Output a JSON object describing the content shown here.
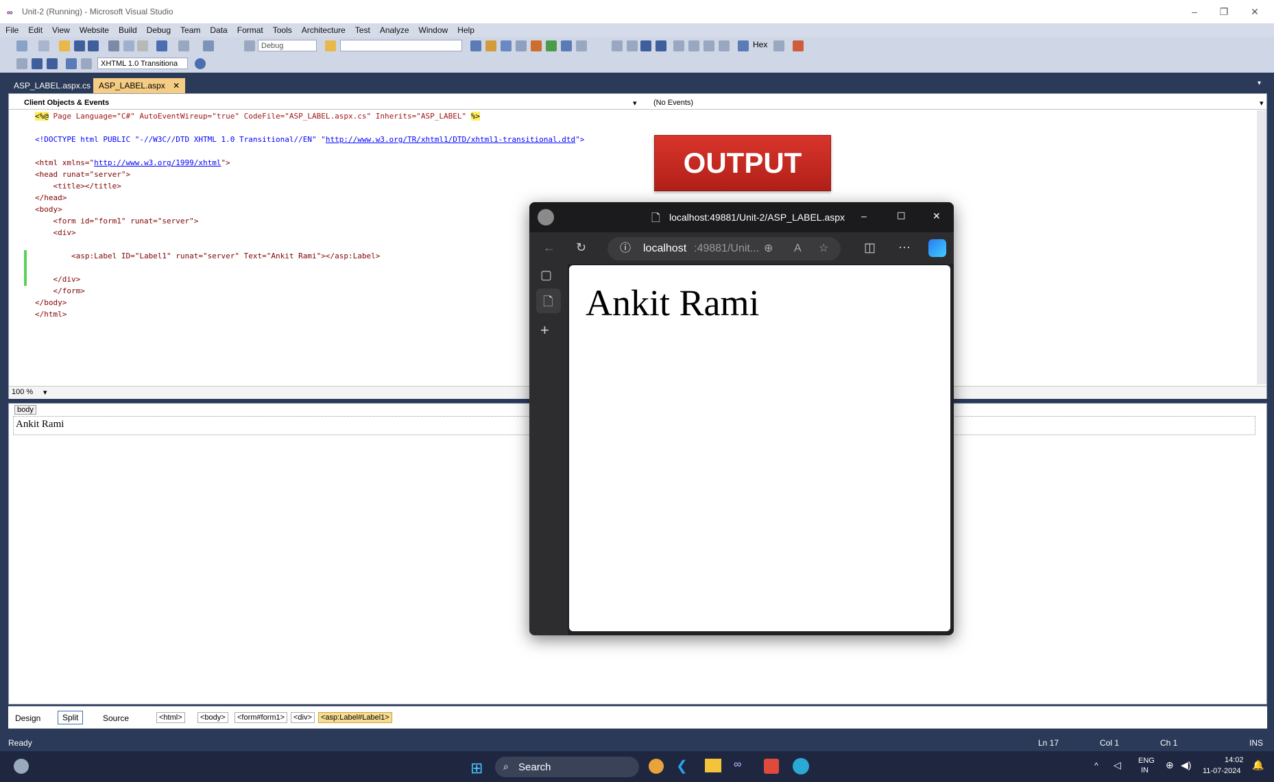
{
  "window": {
    "title": "Unit-2 (Running) - Microsoft Visual Studio"
  },
  "menu": [
    "File",
    "Edit",
    "View",
    "Website",
    "Build",
    "Debug",
    "Team",
    "Data",
    "Format",
    "Tools",
    "Architecture",
    "Test",
    "Analyze",
    "Window",
    "Help"
  ],
  "toolbar": {
    "config_value": "Debug",
    "hex_label": "Hex",
    "doctype_value": "XHTML 1.0 Transitiona"
  },
  "tabs": [
    {
      "label": "ASP_LABEL.aspx.cs",
      "active": false
    },
    {
      "label": "ASP_LABEL.aspx",
      "active": true
    }
  ],
  "editor": {
    "objects_dropdown": "Client Objects & Events",
    "events_dropdown": "(No Events)",
    "zoom": "100 %",
    "code": {
      "l1_a": "<%@",
      "l1_b": " Page Language=\"C#\" AutoEventWireup=\"true\" CodeFile=\"ASP_LABEL.aspx.cs\" Inherits=\"ASP_LABEL\" ",
      "l1_c": "%>",
      "l2_a": "<!DOCTYPE html PUBLIC \"-//W3C//DTD XHTML 1.0 Transitional//EN\" \"",
      "l2_link": "http://www.w3.org/TR/xhtml1/DTD/xhtml1-transitional.dtd",
      "l2_b": "\">",
      "l3_a": "<html xmlns=\"",
      "l3_link": "http://www.w3.org/1999/xhtml",
      "l3_b": "\">",
      "l4": "<head runat=\"server\">",
      "l5": "    <title></title>",
      "l6": "</head>",
      "l7": "<body>",
      "l8": "    <form id=\"form1\" runat=\"server\">",
      "l9": "    <div>",
      "l10": "        <asp:Label ID=\"Label1\" runat=\"server\" Text=\"Ankit Rami\"></asp:Label>",
      "l11": "    </div>",
      "l12": "    </form>",
      "l13": "</body>",
      "l14": "</html>"
    }
  },
  "design": {
    "body_tag": "body",
    "label_text": "Ankit Rami"
  },
  "bottom": {
    "views": [
      "Design",
      "Split",
      "Source"
    ],
    "breadcrumb": [
      "<html>",
      "<body>",
      "<form#form1>",
      "<div>",
      "<asp:Label#Label1>"
    ]
  },
  "status": {
    "text": "Ready",
    "ln": "Ln 17",
    "col": "Col 1",
    "ch": "Ch 1",
    "mode": "INS"
  },
  "output_banner": "OUTPUT",
  "browser": {
    "title": "localhost:49881/Unit-2/ASP_LABEL.aspx",
    "url_host": "localhost",
    "url_rest": ":49881/Unit...",
    "content_text": "Ankit Rami"
  },
  "taskbar": {
    "search_placeholder": "Search",
    "lang": "ENG",
    "region": "IN",
    "time": "14:02",
    "date": "11-07-2024"
  }
}
